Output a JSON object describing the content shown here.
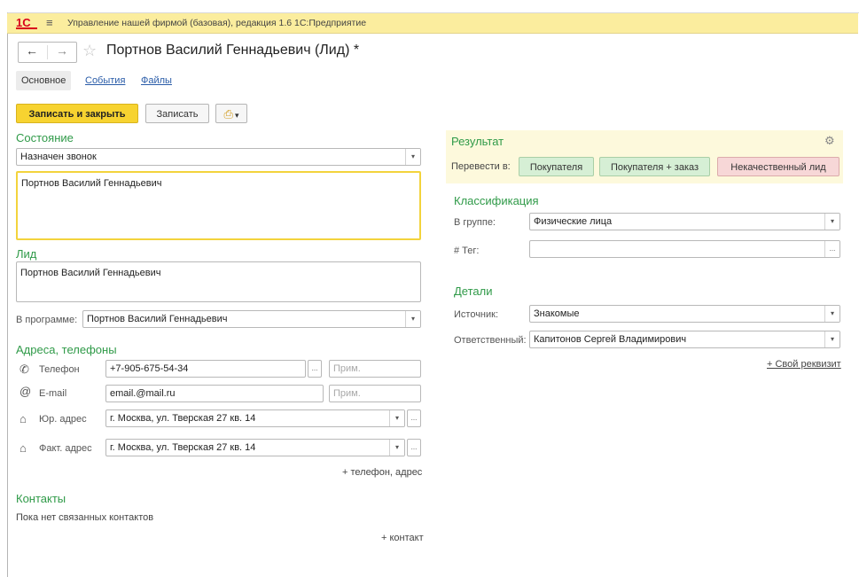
{
  "app": {
    "logo": "1С",
    "title": "Управление нашей фирмой (базовая), редакция 1.6 1С:Предприятие"
  },
  "header": {
    "back": "←",
    "forward": "→",
    "title": "Портнов Василий Геннадьевич (Лид) *"
  },
  "tabs": [
    {
      "label": "Основное"
    },
    {
      "label": "События"
    },
    {
      "label": "Файлы"
    }
  ],
  "toolbar": {
    "save_close": "Записать и закрыть",
    "save": "Записать"
  },
  "left": {
    "state_title": "Состояние",
    "state_value": "Назначен звонок",
    "state_comment": "Портнов Василий Геннадьевич",
    "lead_title": "Лид",
    "lead_value": "Портнов Василий Геннадьевич",
    "program_label": "В программе:",
    "program_value": "Портнов Василий Геннадьевич",
    "addresses_title": "Адреса, телефоны",
    "phone_label": "Телефон",
    "phone_value": "+7-905-675-54-34",
    "email_label": "E-mail",
    "email_value": "email.@mail.ru",
    "note_placeholder": "Прим.",
    "legal_label": "Юр. адрес",
    "legal_value": "г. Москва, ул. Тверская 27 кв. 14",
    "fact_label": "Факт. адрес",
    "fact_value": "г. Москва, ул. Тверская 27 кв. 14",
    "add_phone": "+ телефон, адрес",
    "contacts_title": "Контакты",
    "contacts_empty": "Пока нет связанных контактов",
    "add_contact": "+ контакт"
  },
  "right": {
    "result_title": "Результат",
    "convert_label": "Перевести в:",
    "btn_buyer": "Покупателя",
    "btn_buyer_order": "Покупателя + заказ",
    "btn_bad_lead": "Некачественный лид",
    "class_title": "Классификация",
    "group_label": "В группе:",
    "group_value": "Физические лица",
    "tag_label": "# Тег:",
    "details_title": "Детали",
    "source_label": "Источник:",
    "source_value": "Знакомые",
    "resp_label": "Ответственный:",
    "resp_value": "Капитонов Сергей Владимирович",
    "custom_field": "+ Свой реквизит"
  },
  "icons": {
    "phone": "✆",
    "email": "@",
    "house": "⌂",
    "gear": "⚙",
    "dropdown": "▾",
    "dots": "...",
    "star": "☆",
    "burger": "≡",
    "print": "⎙"
  },
  "colors": {
    "accent_green": "#2f9a48",
    "titlebar": "#fbed9e",
    "primary": "#f7d330"
  }
}
